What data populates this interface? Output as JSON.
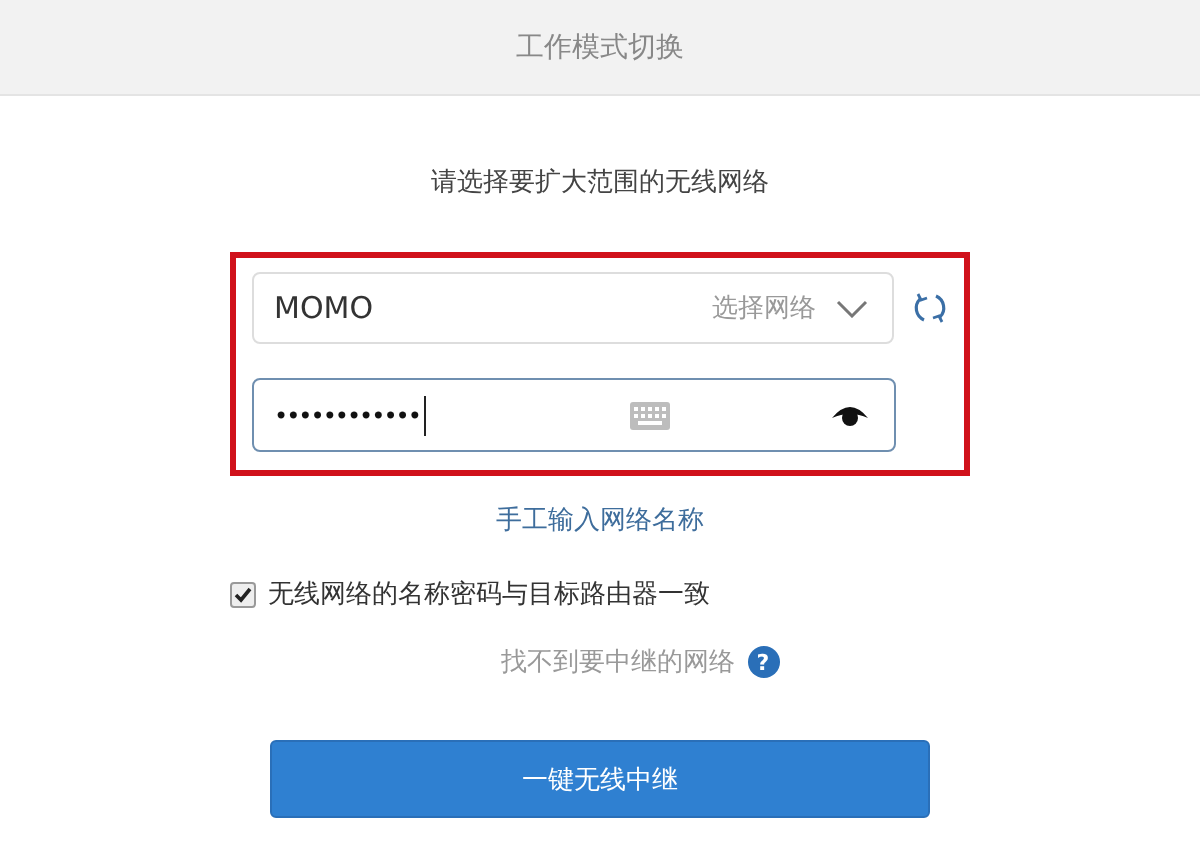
{
  "header": {
    "title": "工作模式切换"
  },
  "prompt": "请选择要扩大范围的无线网络",
  "network_select": {
    "value": "MOMO",
    "hint": "选择网络"
  },
  "password_field": {
    "value": "••••••••••••"
  },
  "manual_link": "手工输入网络名称",
  "same_credentials": {
    "label": "无线网络的名称密码与目标路由器一致",
    "checked": true
  },
  "help_text": "找不到要中继的网络",
  "help_icon": "?",
  "submit_button": "一键无线中继"
}
